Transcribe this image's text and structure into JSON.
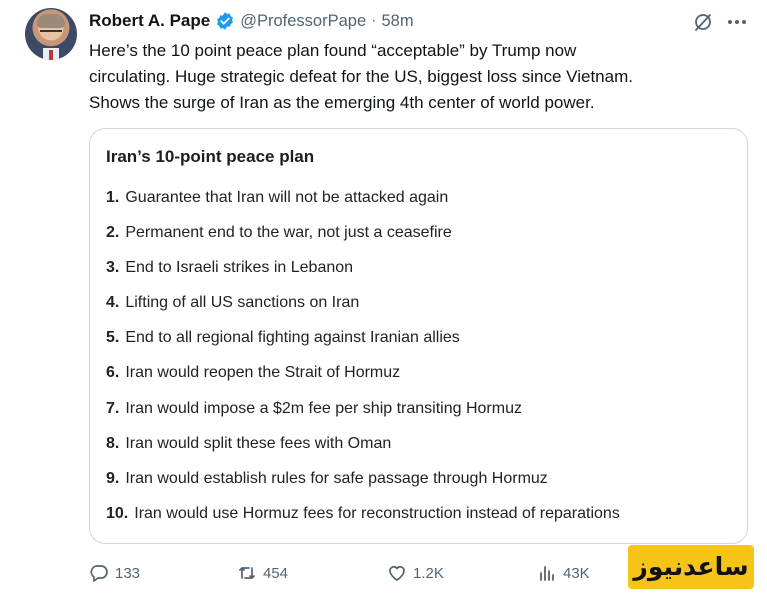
{
  "author": {
    "name": "Robert A. Pape",
    "handle": "@ProfessorPape",
    "separator": "·",
    "time": "58m"
  },
  "tweet": {
    "lines": [
      "Here’s the 10 point peace plan found “acceptable” by Trump now",
      "circulating.  Huge strategic defeat for the US, biggest loss since Vietnam.",
      "Shows the surge of Iran as the emerging 4th center of world power."
    ]
  },
  "card": {
    "title": "Iran’s 10-point peace plan",
    "items": [
      {
        "num": "1.",
        "text": "Guarantee that Iran will not be attacked again"
      },
      {
        "num": "2.",
        "text": "Permanent end to the war, not just a ceasefire"
      },
      {
        "num": "3.",
        "text": "End to Israeli strikes in Lebanon"
      },
      {
        "num": "4.",
        "text": "Lifting of all US sanctions on Iran"
      },
      {
        "num": "5.",
        "text": "End to all regional fighting against Iranian allies"
      },
      {
        "num": "6.",
        "text": "Iran would reopen the Strait of Hormuz"
      },
      {
        "num": "7.",
        "text": "Iran would impose a $2m fee per ship transiting Hormuz"
      },
      {
        "num": "8.",
        "text": "Iran would split these fees with Oman"
      },
      {
        "num": "9.",
        "text": "Iran would establish rules for safe passage through Hormuz"
      },
      {
        "num": "10.",
        "text": "Iran would use Hormuz fees for reconstruction instead of reparations"
      }
    ]
  },
  "actions": {
    "replies": "133",
    "reposts": "454",
    "likes": "1.2K",
    "views": "43K"
  },
  "watermark": "ساعدنیوز",
  "icons": {
    "verified": "verified-badge-icon",
    "grok": "grok-icon",
    "more": "more-icon",
    "reply": "reply-icon",
    "repost": "repost-icon",
    "like": "heart-icon",
    "views": "views-icon"
  },
  "colors": {
    "verified": "#1d9bf0",
    "muted": "#536471",
    "border": "#cfd9de",
    "watermark_bg": "#f6c417"
  }
}
